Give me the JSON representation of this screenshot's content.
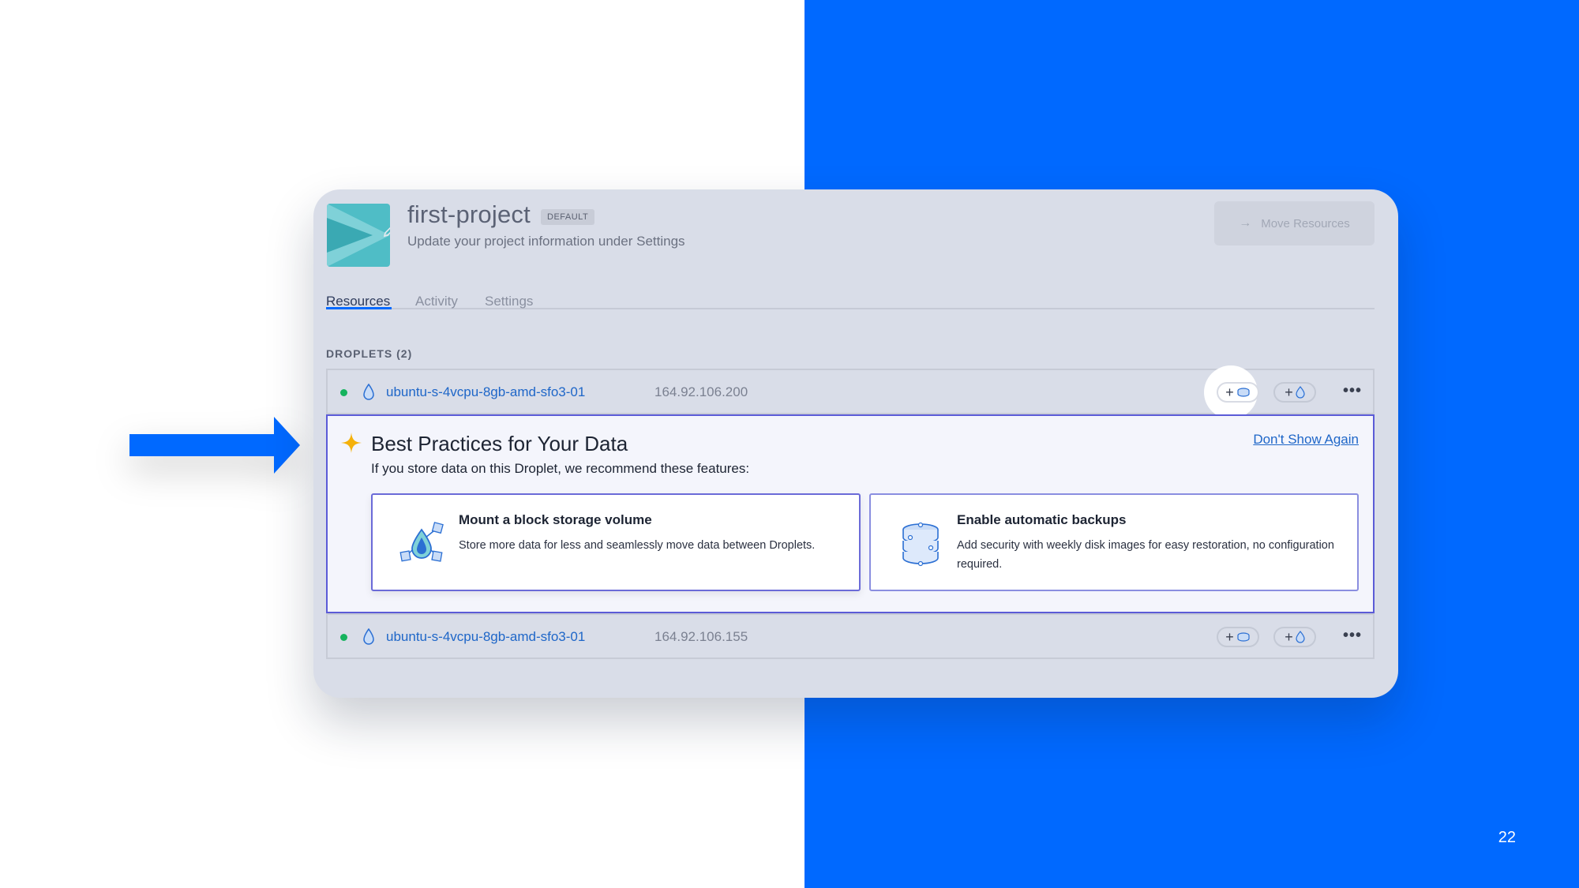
{
  "slide": {
    "page_number": "22"
  },
  "project": {
    "title": "first-project",
    "badge": "DEFAULT",
    "subtitle": "Update your project information under Settings",
    "move_button": "Move Resources"
  },
  "tabs": [
    {
      "label": "Resources",
      "active": true
    },
    {
      "label": "Activity",
      "active": false
    },
    {
      "label": "Settings",
      "active": false
    }
  ],
  "droplets": {
    "section_label": "DROPLETS (2)",
    "items": [
      {
        "name": "ubuntu-s-4vcpu-8gb-amd-sfo3-01",
        "ip": "164.92.106.200",
        "status": "active"
      },
      {
        "name": "ubuntu-s-4vcpu-8gb-amd-sfo3-01",
        "ip": "164.92.106.155",
        "status": "active"
      }
    ],
    "add_volume_icon": "plus-volume-icon",
    "add_droplet_icon": "plus-droplet-icon",
    "more_icon": "more-horizontal-icon"
  },
  "best_practices": {
    "title": "Best Practices for Your Data",
    "subtitle": "If you store data on this Droplet, we recommend these features:",
    "dismiss": "Don't Show Again",
    "cards": [
      {
        "title": "Mount a block storage volume",
        "description": "Store more data for less and seamlessly move data between Droplets.",
        "icon": "block-storage-icon"
      },
      {
        "title": "Enable automatic backups",
        "description": "Add security with weekly disk images for easy restoration, no configuration required.",
        "icon": "backups-icon"
      }
    ]
  },
  "colors": {
    "accent_blue": "#0069ff",
    "link_blue": "#1e66c8",
    "panel_border": "#5b5bd7",
    "status_green": "#16b35e",
    "star_gold": "#f5b10a"
  }
}
